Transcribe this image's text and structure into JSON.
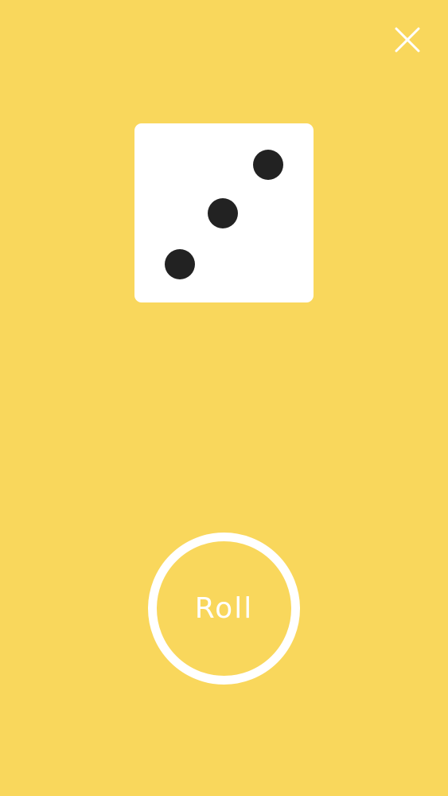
{
  "screen": {
    "background_color": "#f9d75c"
  },
  "close": {
    "icon": "close-icon",
    "color": "#ffffff"
  },
  "die": {
    "face_value": 3,
    "face_color": "#ffffff",
    "pip_color": "#222222"
  },
  "roll_button": {
    "label": "Roll",
    "color": "#ffffff"
  }
}
